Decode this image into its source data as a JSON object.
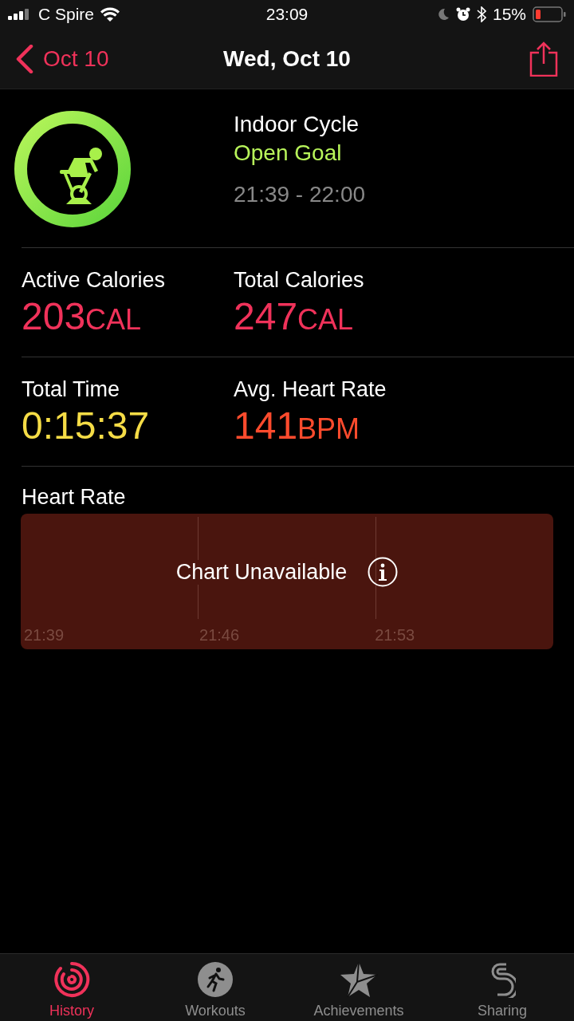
{
  "status_bar": {
    "carrier": "C Spire",
    "time": "23:09",
    "battery": "15%"
  },
  "nav": {
    "back": "Oct 10",
    "title": "Wed, Oct 10"
  },
  "workout": {
    "name": "Indoor Cycle",
    "goal": "Open Goal",
    "time_range": "21:39 - 22:00"
  },
  "stats": [
    [
      {
        "label": "Active Calories",
        "value": "203",
        "unit": "CAL",
        "color": "#f0325a"
      },
      {
        "label": "Total Calories",
        "value": "247",
        "unit": "CAL",
        "color": "#f0325a"
      }
    ],
    [
      {
        "label": "Total Time",
        "value": "0:15:37",
        "color": "#f5dc46"
      },
      {
        "label": "Avg. Heart Rate",
        "value": "141",
        "unit": "BPM",
        "color": "#ff4b2d"
      }
    ]
  ],
  "heart_rate": {
    "title": "Heart Rate",
    "message": "Chart Unavailable",
    "ticks": [
      "21:39",
      "21:46",
      "21:53"
    ]
  },
  "tabs": [
    {
      "label": "History",
      "kind": "history",
      "selected": true
    },
    {
      "label": "Workouts",
      "kind": "workouts",
      "selected": false
    },
    {
      "label": "Achievements",
      "kind": "achievements",
      "selected": false
    },
    {
      "label": "Sharing",
      "kind": "sharing",
      "selected": false
    }
  ]
}
